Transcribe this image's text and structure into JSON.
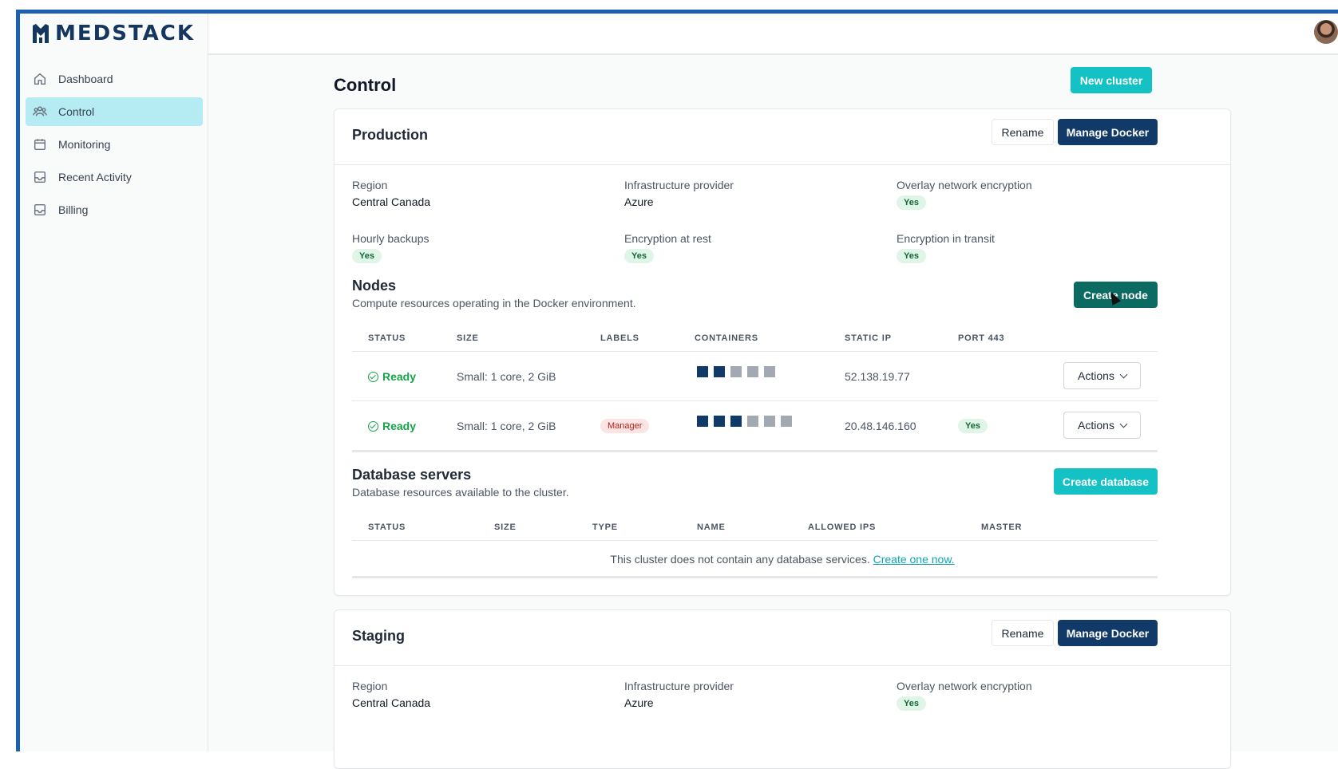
{
  "app": {
    "logo_text": "MEDSTACK"
  },
  "sidebar": {
    "items": [
      {
        "label": "Dashboard",
        "icon": "home-icon"
      },
      {
        "label": "Control",
        "icon": "users-icon",
        "active": true
      },
      {
        "label": "Monitoring",
        "icon": "calendar-icon"
      },
      {
        "label": "Recent Activity",
        "icon": "inbox-icon"
      },
      {
        "label": "Billing",
        "icon": "inbox-icon"
      }
    ]
  },
  "header": {
    "avatar": "user-avatar"
  },
  "page": {
    "title": "Control",
    "new_cluster_label": "New cluster"
  },
  "clusters": [
    {
      "name": "Production",
      "rename_label": "Rename",
      "manage_label": "Manage Docker",
      "region_label": "Region",
      "region": "Central Canada",
      "provider_label": "Infrastructure provider",
      "provider": "Azure",
      "overlay_label": "Overlay network encryption",
      "overlay": "Yes",
      "backups_label": "Hourly backups",
      "backups": "Yes",
      "rest_label": "Encryption at rest",
      "rest": "Yes",
      "transit_label": "Encryption in transit",
      "transit": "Yes",
      "nodes": {
        "title": "Nodes",
        "subtitle": "Compute resources operating in the Docker environment.",
        "create_label": "Create node",
        "columns": [
          "STATUS",
          "SIZE",
          "LABELS",
          "CONTAINERS",
          "STATIC IP",
          "PORT 443"
        ],
        "rows": [
          {
            "status": "Ready",
            "size": "Small: 1 core, 2 GiB",
            "label": "",
            "containers_on": 2,
            "containers_total": 5,
            "ip": "52.138.19.77",
            "port": "",
            "actions": "Actions"
          },
          {
            "status": "Ready",
            "size": "Small: 1 core, 2 GiB",
            "label": "Manager",
            "containers_on": 3,
            "containers_total": 6,
            "ip": "20.48.146.160",
            "port": "Yes",
            "actions": "Actions"
          }
        ]
      },
      "databases": {
        "title": "Database servers",
        "subtitle": "Database resources available to the cluster.",
        "create_label": "Create database",
        "columns": [
          "STATUS",
          "SIZE",
          "TYPE",
          "NAME",
          "ALLOWED IPS",
          "MASTER"
        ],
        "empty_text": "This cluster does not contain any database services.",
        "empty_link": "Create one now."
      }
    },
    {
      "name": "Staging",
      "rename_label": "Rename",
      "manage_label": "Manage Docker",
      "region_label": "Region",
      "region": "Central Canada",
      "provider_label": "Infrastructure provider",
      "provider": "Azure",
      "overlay_label": "Overlay network encryption",
      "overlay": "Yes"
    }
  ],
  "colors": {
    "accent_teal": "#14c1c4",
    "navy": "#123a68",
    "dark_teal": "#0b6b63",
    "active_nav": "#b5ecf3",
    "frame_blue": "#1d5fb0"
  }
}
